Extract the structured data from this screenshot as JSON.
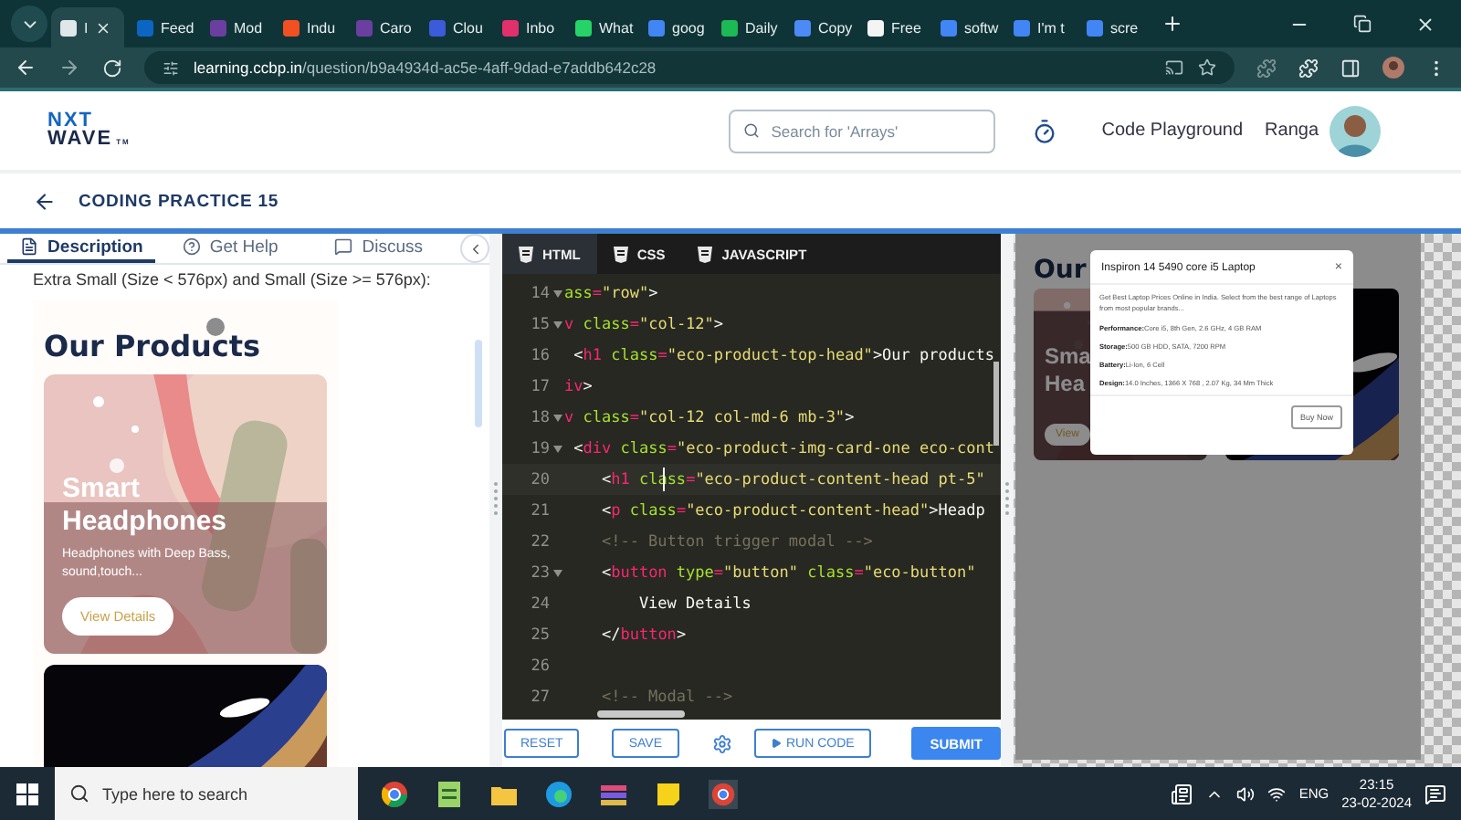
{
  "browser": {
    "tabs": [
      {
        "label": "I",
        "selected": true,
        "color": "#dfe7ea"
      },
      {
        "label": "Feed",
        "selected": false,
        "color": "#0a66c2"
      },
      {
        "label": "Mod",
        "selected": false,
        "color": "#6b3fa0"
      },
      {
        "label": "Indu",
        "selected": false,
        "color": "#f25022"
      },
      {
        "label": "Caro",
        "selected": false,
        "color": "#6b3fa0"
      },
      {
        "label": "Clou",
        "selected": false,
        "color": "#3b5bdb"
      },
      {
        "label": "Inbo",
        "selected": false,
        "color": "#e1306c"
      },
      {
        "label": "What",
        "selected": false,
        "color": "#25d366"
      },
      {
        "label": "goog",
        "selected": false,
        "color": "#4285f4"
      },
      {
        "label": "Daily",
        "selected": false,
        "color": "#1db954"
      },
      {
        "label": "Copy",
        "selected": false,
        "color": "#4c8bf5"
      },
      {
        "label": "Free",
        "selected": false,
        "color": "#f4f4f4"
      },
      {
        "label": "softw",
        "selected": false,
        "color": "#4285f4"
      },
      {
        "label": "I'm t",
        "selected": false,
        "color": "#4285f4"
      },
      {
        "label": "scre",
        "selected": false,
        "color": "#4285f4"
      }
    ],
    "url": {
      "host": "learning.ccbp.in",
      "path": "/question/b9a4934d-ac5e-4aff-9dad-e7addb642c28"
    }
  },
  "header": {
    "logo": {
      "line1": "NXT",
      "line2": "WAVE",
      "mark": "TM"
    },
    "search": {
      "placeholder": "Search for 'Arrays'"
    },
    "playground": "Code Playground",
    "user": "Ranga"
  },
  "practice": {
    "title": "CODING PRACTICE 15"
  },
  "left_panel": {
    "tabs": [
      {
        "label": "Description",
        "selected": true
      },
      {
        "label": "Get Help",
        "selected": false
      },
      {
        "label": "Discuss",
        "selected": false
      }
    ],
    "text": "Extra Small (Size < 576px) and Small (Size >= 576px):",
    "preview": {
      "heading": "Our Products",
      "card": {
        "title_1": "Smart",
        "title_2": "Headphones",
        "body": "Headphones with Deep Bass, sound,touch...",
        "button": "View Details"
      }
    }
  },
  "editor": {
    "tabs": [
      {
        "label": "HTML",
        "selected": true
      },
      {
        "label": "CSS",
        "selected": false
      },
      {
        "label": "JAVASCRIPT",
        "selected": false
      }
    ],
    "lines": [
      {
        "number": "14",
        "foldable": true,
        "active": false,
        "tokens": [
          {
            "kind": "attr",
            "text": "ass"
          },
          {
            "kind": "op",
            "text": "="
          },
          {
            "kind": "string",
            "text": "\"row\""
          },
          {
            "kind": "plain",
            "text": ">"
          }
        ]
      },
      {
        "number": "15",
        "foldable": true,
        "active": false,
        "tokens": [
          {
            "kind": "tag",
            "text": "v"
          },
          {
            "kind": "attr",
            "text": " class"
          },
          {
            "kind": "op",
            "text": "="
          },
          {
            "kind": "string",
            "text": "\"col-12\""
          },
          {
            "kind": "plain",
            "text": ">"
          }
        ]
      },
      {
        "number": "16",
        "foldable": false,
        "active": false,
        "tokens": [
          {
            "kind": "plain",
            "text": " <"
          },
          {
            "kind": "tag",
            "text": "h1"
          },
          {
            "kind": "attr",
            "text": " class"
          },
          {
            "kind": "op",
            "text": "="
          },
          {
            "kind": "string",
            "text": "\"eco-product-top-head\""
          },
          {
            "kind": "plain",
            "text": ">Our products"
          }
        ]
      },
      {
        "number": "17",
        "foldable": false,
        "active": false,
        "tokens": [
          {
            "kind": "tag",
            "text": "iv"
          },
          {
            "kind": "plain",
            "text": ">"
          }
        ]
      },
      {
        "number": "18",
        "foldable": true,
        "active": false,
        "tokens": [
          {
            "kind": "tag",
            "text": "v"
          },
          {
            "kind": "attr",
            "text": " class"
          },
          {
            "kind": "op",
            "text": "="
          },
          {
            "kind": "string",
            "text": "\"col-12 col-md-6 mb-3\""
          },
          {
            "kind": "plain",
            "text": ">"
          }
        ]
      },
      {
        "number": "19",
        "foldable": true,
        "active": false,
        "tokens": [
          {
            "kind": "plain",
            "text": " <"
          },
          {
            "kind": "tag",
            "text": "div"
          },
          {
            "kind": "attr",
            "text": " class"
          },
          {
            "kind": "op",
            "text": "="
          },
          {
            "kind": "string",
            "text": "\"eco-product-img-card-one eco-cont"
          }
        ]
      },
      {
        "number": "20",
        "foldable": false,
        "active": true,
        "tokens": [
          {
            "kind": "plain",
            "text": "    <"
          },
          {
            "kind": "tag",
            "text": "h1"
          },
          {
            "kind": "attr",
            "text": " class"
          },
          {
            "kind": "op",
            "text": "="
          },
          {
            "kind": "string",
            "text": "\"eco-product-content-head pt-5\""
          }
        ]
      },
      {
        "number": "21",
        "foldable": false,
        "active": false,
        "tokens": [
          {
            "kind": "plain",
            "text": "    <"
          },
          {
            "kind": "tag",
            "text": "p"
          },
          {
            "kind": "attr",
            "text": " class"
          },
          {
            "kind": "op",
            "text": "="
          },
          {
            "kind": "string",
            "text": "\"eco-product-content-head\""
          },
          {
            "kind": "plain",
            "text": ">Headp"
          }
        ]
      },
      {
        "number": "22",
        "foldable": false,
        "active": false,
        "tokens": [
          {
            "kind": "comment",
            "text": "    <!-- Button trigger modal -->"
          }
        ]
      },
      {
        "number": "23",
        "foldable": true,
        "active": false,
        "tokens": [
          {
            "kind": "plain",
            "text": "    <"
          },
          {
            "kind": "tag",
            "text": "button"
          },
          {
            "kind": "attr",
            "text": " type"
          },
          {
            "kind": "op",
            "text": "="
          },
          {
            "kind": "string",
            "text": "\"button\""
          },
          {
            "kind": "attr",
            "text": " class"
          },
          {
            "kind": "op",
            "text": "="
          },
          {
            "kind": "string",
            "text": "\"eco-button\""
          }
        ]
      },
      {
        "number": "24",
        "foldable": false,
        "active": false,
        "tokens": [
          {
            "kind": "plain",
            "text": "        View Details"
          }
        ]
      },
      {
        "number": "25",
        "foldable": false,
        "active": false,
        "tokens": [
          {
            "kind": "plain",
            "text": "    </"
          },
          {
            "kind": "tag",
            "text": "button"
          },
          {
            "kind": "plain",
            "text": ">"
          }
        ]
      },
      {
        "number": "26",
        "foldable": false,
        "active": false
      },
      {
        "number": "27",
        "foldable": false,
        "active": false,
        "tokens": [
          {
            "kind": "comment",
            "text": "    <!-- Modal -->"
          }
        ]
      }
    ],
    "buttons": {
      "reset": "RESET",
      "save": "SAVE",
      "run": "RUN CODE",
      "submit": "SUBMIT"
    }
  },
  "output": {
    "heading": "Our",
    "card": {
      "title_1": "Sma",
      "title_2": "Hea",
      "button": "View"
    },
    "modal": {
      "title": "Inspiron 14 5490 core i5 Laptop",
      "close": "×",
      "description": "Get Best Laptop Prices Online in India. Select from the best range of Laptops from most popular brands...",
      "specs": [
        {
          "label": "Performance:",
          "value": "Core i5, 8th Gen, 2.6 GHz, 4 GB RAM"
        },
        {
          "label": "Storage:",
          "value": "500 GB HDD, SATA, 7200 RPM"
        },
        {
          "label": "Battery:",
          "value": "Li-Ion, 6 Cell"
        },
        {
          "label": "Design:",
          "value": "14.0 Inches, 1366 X 768 , 2.07 Kg, 34 Mm Thick"
        }
      ],
      "button": "Buy Now"
    }
  },
  "taskbar": {
    "search": {
      "placeholder": "Type here to search"
    },
    "language": "ENG",
    "time": "23:15",
    "date": "23-02-2024"
  }
}
